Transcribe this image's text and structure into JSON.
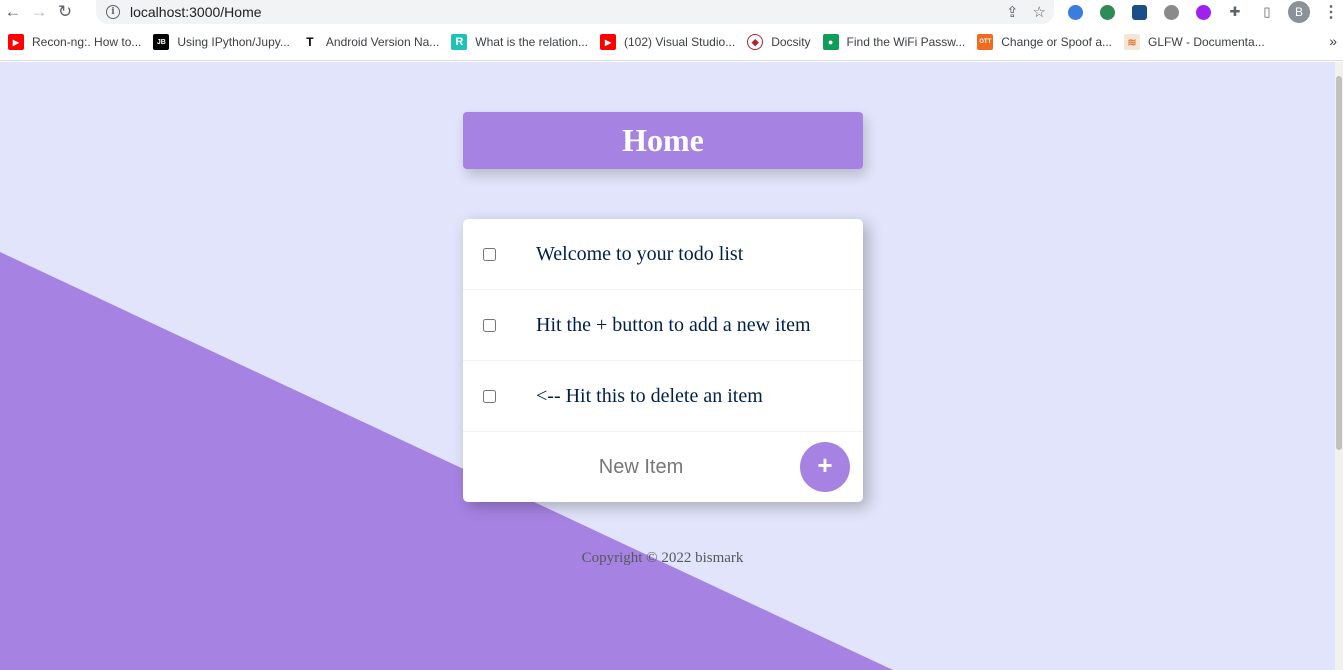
{
  "browser": {
    "url": "localhost:3000/Home",
    "profile_initial": "B",
    "bookmarks": [
      {
        "label": "Recon-ng:. How to...",
        "icon": "youtube-icon",
        "color": "#ff0000",
        "glyph": "▶"
      },
      {
        "label": "Using IPython/Jupy...",
        "icon": "jetbrains-icon",
        "color": "#000000",
        "glyph": "JB"
      },
      {
        "label": "Android Version Na...",
        "icon": "t-logo-icon",
        "color": "#ffffff",
        "glyph": "T"
      },
      {
        "label": "What is the relation...",
        "icon": "r-logo-icon",
        "color": "#1fc2b7",
        "glyph": "R"
      },
      {
        "label": "(102) Visual Studio...",
        "icon": "youtube-icon",
        "color": "#ff0000",
        "glyph": "▶"
      },
      {
        "label": "Docsity",
        "icon": "docsity-icon",
        "color": "#b1232e",
        "glyph": "◆"
      },
      {
        "label": "Find the WiFi Passw...",
        "icon": "person-icon",
        "color": "#0f9d58",
        "glyph": "●"
      },
      {
        "label": "Change or Spoof a...",
        "icon": "ott-icon",
        "color": "#f26b1d",
        "glyph": "OTT"
      },
      {
        "label": "GLFW - Documenta...",
        "icon": "glfw-icon",
        "color": "#e8a87c",
        "glyph": "≋"
      }
    ]
  },
  "page": {
    "heading": "Home",
    "items": [
      {
        "text": "Welcome to your todo list",
        "checked": false
      },
      {
        "text": "Hit the + button to add a new item",
        "checked": false
      },
      {
        "text": "<-- Hit this to delete an item",
        "checked": false
      }
    ],
    "new_item_placeholder": "New Item",
    "add_button_label": "+",
    "footer": "Copyright © 2022 bismark"
  },
  "colors": {
    "page_background": "#e1e4fa",
    "accent": "#a683e3",
    "item_text": "#00204a"
  }
}
